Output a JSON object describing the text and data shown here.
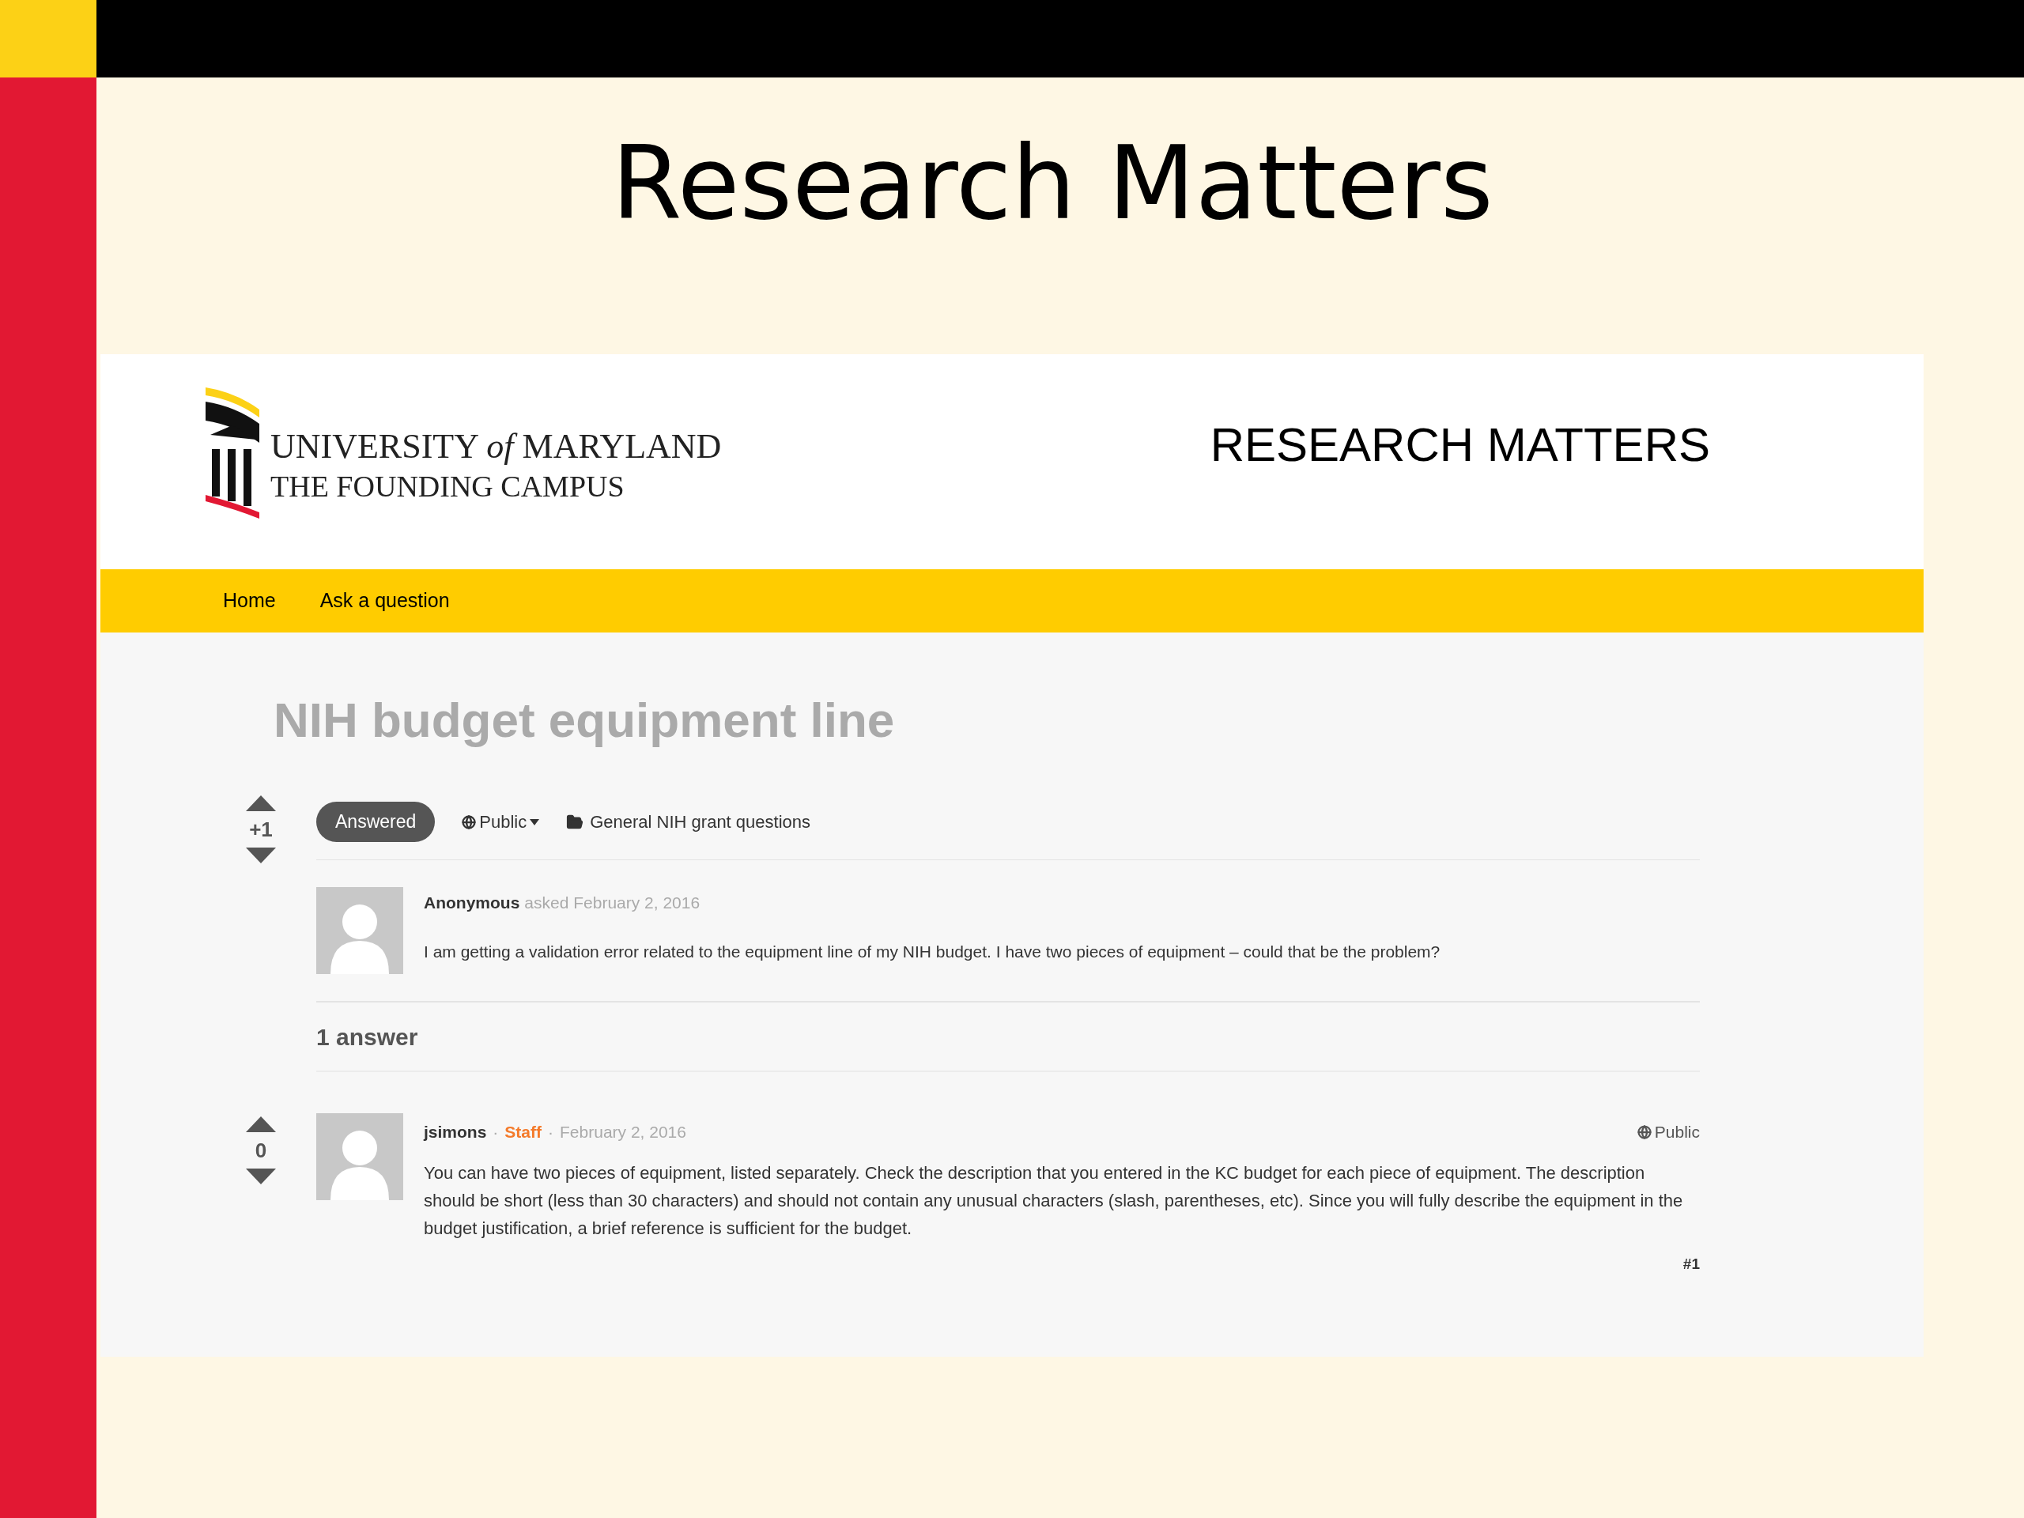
{
  "slide": {
    "title": "Research Matters"
  },
  "site": {
    "logo_lines": [
      "UNIVERSITY *of* MARYLAND",
      "THE FOUNDING CAMPUS"
    ],
    "title": "RESEARCH MATTERS",
    "nav": [
      {
        "label": "Home"
      },
      {
        "label": "Ask a question"
      }
    ]
  },
  "question": {
    "title": "NIH budget equipment line",
    "votes": "+1",
    "status": "Answered",
    "visibility": "Public",
    "category": "General NIH grant questions",
    "author": "Anonymous",
    "meta": "asked February 2, 2016",
    "body": "I am getting a validation error related to the equipment line of my NIH budget. I have two pieces of equipment – could that be the problem?"
  },
  "answers_heading": "1 answer",
  "answers": [
    {
      "votes": "0",
      "author": "jsimons",
      "separator": "·",
      "role": "Staff",
      "date": "February 2, 2016",
      "visibility": "Public",
      "body": "You can have two pieces of equipment, listed separately. Check the description that you entered in the KC budget for each piece of equipment. The description should be short (less than 30 characters) and should not contain any unusual characters (slash, parentheses, etc). Since you will fully describe the equipment in the budget justification, a brief reference is sufficient for the budget.",
      "number": "#1"
    }
  ]
}
